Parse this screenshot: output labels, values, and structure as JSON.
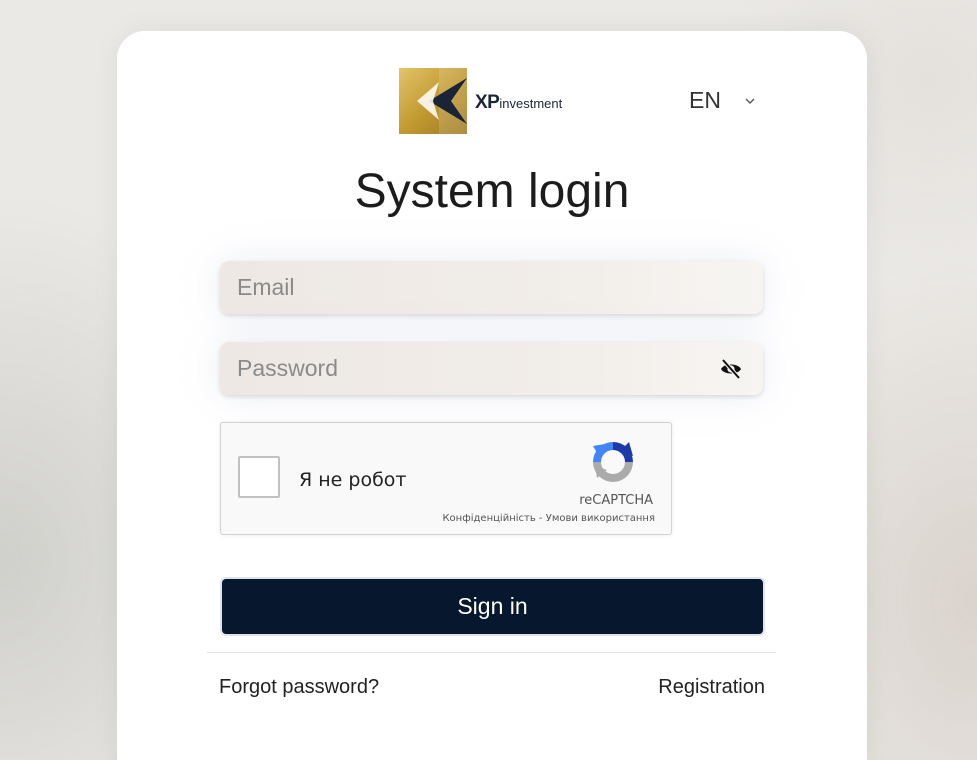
{
  "brand": {
    "name_bold": "XP",
    "name_light": "investment",
    "accent_gold": "#c9a43a",
    "accent_navy": "#1a2436"
  },
  "language": {
    "selected": "EN",
    "icon": "chevron-down-icon"
  },
  "login": {
    "title": "System login",
    "email_placeholder": "Email",
    "password_placeholder": "Password",
    "password_toggle_icon": "eye-slash-icon",
    "signin_label": "Sign in",
    "signin_color": "#07172d"
  },
  "captcha": {
    "label": "Я не робот",
    "brand": "reCAPTCHA",
    "privacy": "Конфіденційність",
    "separator": " - ",
    "terms": "Умови використання"
  },
  "footer": {
    "forgot": "Forgot password?",
    "register": "Registration"
  }
}
